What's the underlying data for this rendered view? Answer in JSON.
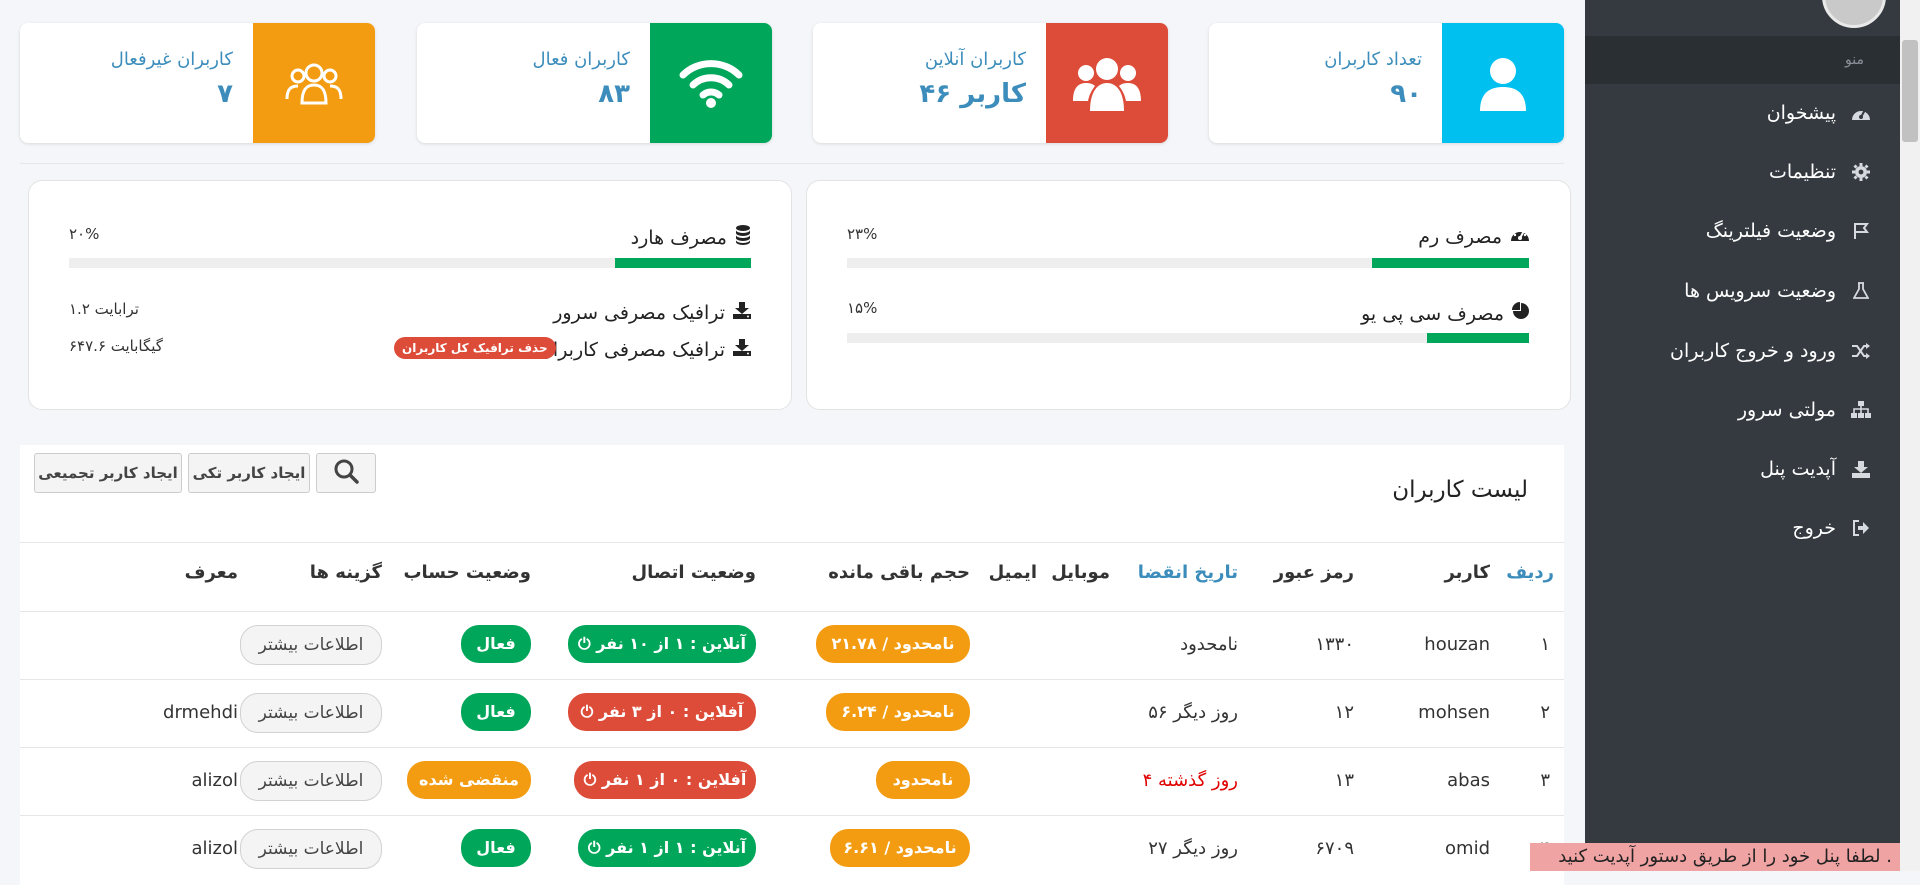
{
  "colors": {
    "blue": "#00c0ef",
    "red": "#dd4b39",
    "green": "#00a65a",
    "orange": "#f39c12",
    "link": "#3c8dbc",
    "sidebar": "#343a40"
  },
  "stats": [
    {
      "label": "تعداد کاربران",
      "value": "۹۰",
      "icon": "user-icon",
      "color": "#00c0ef"
    },
    {
      "label": "کاربران آنلاین",
      "value": "۴۶ کاربر",
      "icon": "users-group-icon",
      "color": "#dd4b39"
    },
    {
      "label": "کاربران فعال",
      "value": "۸۳",
      "icon": "wifi-icon",
      "color": "#00a65a"
    },
    {
      "label": "کاربران غیرفعال",
      "value": "۷",
      "icon": "inactive-users-icon",
      "color": "#f39c12"
    }
  ],
  "resources": {
    "ram": {
      "label": "مصرف رم",
      "percent_text": "۲۳%",
      "percent": 23,
      "icon": "gauge-icon"
    },
    "cpu": {
      "label": "مصرف سی پی یو",
      "percent_text": "۱۵%",
      "percent": 15,
      "icon": "pie-icon"
    },
    "disk": {
      "label": "مصرف هارد",
      "percent_text": "۲۰%",
      "percent": 20,
      "icon": "database-icon"
    },
    "server_traffic": {
      "label": "ترافیک مصرفی سرور",
      "value": "۱.۲ ترابایت",
      "icon": "download-icon"
    },
    "users_traffic": {
      "label": "ترافیک مصرفی کاربران",
      "value": "۶۴۷.۶ گیگابایت",
      "icon": "download-icon",
      "delete_label": "حذف ترافیک کل کاربران"
    }
  },
  "sidebar": {
    "menu_header": "منو",
    "items": [
      {
        "label": "پیشخوان",
        "icon": "dashboard-icon"
      },
      {
        "label": "تنظیمات",
        "icon": "gear-icon"
      },
      {
        "label": "وضعیت فیلترینگ",
        "icon": "flag-icon"
      },
      {
        "label": "وضعیت سرویس ها",
        "icon": "flask-icon"
      },
      {
        "label": "ورود و خروج کاربران",
        "icon": "shuffle-icon"
      },
      {
        "label": "مولتی سرور",
        "icon": "sitemap-icon"
      },
      {
        "label": "آپدیت پنل",
        "icon": "download-icon"
      },
      {
        "label": "خروج",
        "icon": "sign-out-icon"
      }
    ]
  },
  "users_list": {
    "title": "لیست کاربران",
    "bulk_create_label": "ایجاد کاربر تجمیعی",
    "single_create_label": "ایجاد کاربر تکی",
    "search_icon": "search-icon",
    "headers": {
      "row": "ردیف",
      "user": "کاربر",
      "password": "رمز عبور",
      "expiry": "تاریخ انقضا",
      "mobile": "موبایل",
      "email": "ایمیل",
      "remaining": "حجم باقی مانده",
      "connection": "وضعیت اتصال",
      "account": "وضعیت حساب",
      "options": "گزینه ها",
      "referrer": "معرف"
    },
    "rows": [
      {
        "index": "۱",
        "user": "houzan",
        "password": "۱۳۳۰",
        "expiry": "نامحدود",
        "expiry_expired": false,
        "remaining": "۲۱.۷۸ / نامحدود",
        "connection": "آنلاین : ۱ از ۱۰ نفر",
        "connection_online": true,
        "account": "فعال",
        "account_status": "active",
        "more_label": "اطلاعات بیشتر",
        "referrer": ""
      },
      {
        "index": "۲",
        "user": "mohsen",
        "password": "۱۲",
        "expiry": "۵۶ روز دیگر",
        "expiry_expired": false,
        "remaining": "۶.۲۴ / نامحدود",
        "connection": "آفلاین : ۰ از ۳ نفر",
        "connection_online": false,
        "account": "فعال",
        "account_status": "active",
        "more_label": "اطلاعات بیشتر",
        "referrer": "drmehdi"
      },
      {
        "index": "۳",
        "user": "abas",
        "password": "۱۳",
        "expiry": "۴ روز گذشته",
        "expiry_expired": true,
        "remaining": "نامحدود",
        "connection": "آفلاین : ۰ از ۱ نفر",
        "connection_online": false,
        "account": "منقضی شده",
        "account_status": "expired",
        "more_label": "اطلاعات بیشتر",
        "referrer": "alizol"
      },
      {
        "index": "۴",
        "user": "omid",
        "password": "۶۷۰۹",
        "expiry": "۲۷ روز دیگر",
        "expiry_expired": false,
        "remaining": "۶.۶۱ / نامحدود",
        "connection": "آنلاین : ۱ از ۱ نفر",
        "connection_online": true,
        "account": "فعال",
        "account_status": "active",
        "more_label": "اطلاعات بیشتر",
        "referrer": "alizol"
      }
    ]
  },
  "notice": "لطفا پنل خود را از طریق دستور آپدیت کنید ."
}
